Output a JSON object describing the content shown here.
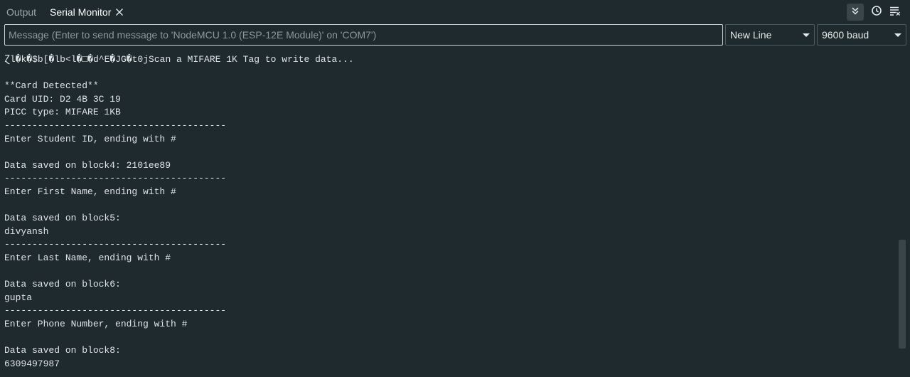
{
  "tabs": [
    {
      "label": "Output",
      "active": false
    },
    {
      "label": "Serial Monitor",
      "active": true
    }
  ],
  "toolbar_icons": [
    "toggle-autoscroll-icon",
    "toggle-timestamp-icon",
    "clear-output-icon"
  ],
  "message_input": {
    "placeholder": "Message (Enter to send message to 'NodeMCU 1.0 (ESP-12E Module)' on 'COM7')",
    "value": ""
  },
  "line_ending": {
    "selected": "New Line"
  },
  "baud_rate": {
    "selected": "9600 baud"
  },
  "console_lines": [
    "Ɀl�k�$b[�lb<l�□�d^E�JG�t0jScan a MIFARE 1K Tag to write data...",
    "",
    "**Card Detected**",
    "Card UID: D2 4B 3C 19",
    "PICC type: MIFARE 1KB",
    "----------------------------------------",
    "Enter Student ID, ending with #",
    "",
    "Data saved on block4: 2101ee89",
    "----------------------------------------",
    "Enter First Name, ending with #",
    "",
    "Data saved on block5:",
    "divyansh",
    "----------------------------------------",
    "Enter Last Name, ending with #",
    "",
    "Data saved on block6:",
    "gupta",
    "----------------------------------------",
    "Enter Phone Number, ending with #",
    "",
    "Data saved on block8:",
    "6309497987"
  ],
  "colors": {
    "background": "#1f2a2e",
    "text": "#dfe4e6",
    "active_button_bg": "#3a4549"
  }
}
